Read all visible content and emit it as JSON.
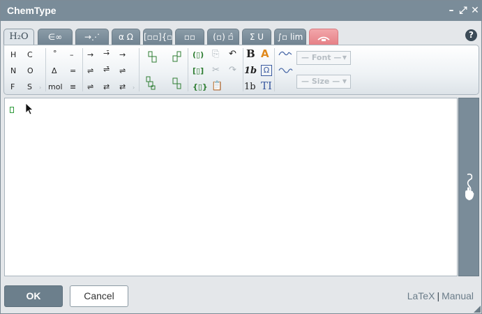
{
  "window": {
    "title": "ChemType",
    "controls": {
      "minimize": "–",
      "maximize": "⤢",
      "close": "✕"
    }
  },
  "tabs": [
    {
      "label": "H₂O",
      "icon": "chemistry-tab-icon",
      "active": true
    },
    {
      "label": "∈∞",
      "icon": "symbols-tab-icon"
    },
    {
      "label": "→⋰",
      "icon": "arrows-tab-icon"
    },
    {
      "label": "α Ω",
      "icon": "greek-tab-icon"
    },
    {
      "label": "[▫▫]{▫",
      "icon": "matrix-tab-icon"
    },
    {
      "label": "▫▫",
      "icon": "scripts-tab-icon"
    },
    {
      "label": "(▫) ▫̂",
      "icon": "brackets-tab-icon"
    },
    {
      "label": "Σ U",
      "icon": "sums-tab-icon"
    },
    {
      "label": "∫▫ lim",
      "icon": "calculus-tab-icon"
    },
    {
      "label": "",
      "icon": "special-tab-icon"
    }
  ],
  "help": "?",
  "toolbar": {
    "elements": [
      "H",
      "C",
      "N",
      "O",
      "F",
      "S"
    ],
    "symbols": [
      "°",
      "–",
      "Δ",
      "=",
      "mol",
      "≡"
    ],
    "arrows": [
      "→",
      "→̄",
      "→",
      "⇌",
      "⇌̄",
      "⇌",
      "⇌",
      "⇄",
      "⇄"
    ],
    "bold": "B",
    "italic_1b": "1b",
    "roman_1b": "1b",
    "text_cursor": "TI",
    "font_select": "— Font —",
    "size_select": "— Size —"
  },
  "editor": {
    "content": ""
  },
  "buttons": {
    "ok": "OK",
    "cancel": "Cancel"
  },
  "links": {
    "latex": "LaTeX",
    "separator": "|",
    "manual": "Manual"
  },
  "colors": {
    "titlebar": "#7a8c99",
    "ok_button": "#6c7f8c",
    "cursor_box": "#2e9a3a",
    "special_tab": "#e57f85"
  }
}
